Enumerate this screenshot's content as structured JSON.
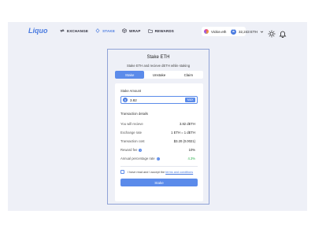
{
  "brand": {
    "logo": "Liquo"
  },
  "nav": {
    "items": [
      {
        "label": "Exchange",
        "icon": "exchange-icon",
        "active": false
      },
      {
        "label": "Stake",
        "icon": "stake-icon",
        "active": true
      },
      {
        "label": "Wrap",
        "icon": "wrap-icon",
        "active": false
      },
      {
        "label": "Rewards",
        "icon": "rewards-icon",
        "active": false
      }
    ]
  },
  "account": {
    "name": "Vickie.eth",
    "balance": "32,243 ETH"
  },
  "card": {
    "title": "Stake ETH",
    "subtitle": "Stake ETH and recieve dETH while staking",
    "tabs": [
      {
        "label": "Stake",
        "active": true
      },
      {
        "label": "Unstake",
        "active": false
      },
      {
        "label": "Claim",
        "active": false
      }
    ],
    "amount": {
      "label": "Stake Amount",
      "value": "3.82",
      "currency_symbol": "Ξ",
      "max_label": "MAX"
    },
    "details_title": "Transaction details",
    "rows": [
      {
        "key": "You will recieve",
        "value": "3.82 dETH"
      },
      {
        "key": "Exchange rate",
        "value": "1 ETH = 1 dETH"
      },
      {
        "key": "Transaction cost",
        "value": "$3.20 (0.0021)"
      },
      {
        "key": "Reward fee",
        "value": "10%",
        "info": true
      },
      {
        "key": "Annual percentage rate",
        "value": "4.3%",
        "info": true,
        "highlight": "green"
      }
    ],
    "terms_prefix": "I have read and I accept the",
    "terms_link": "terms and conditions",
    "submit_label": "Stake"
  },
  "colors": {
    "accent": "#5b8bea",
    "frame_bg": "#eef0f7",
    "positive": "#2fae4e"
  }
}
